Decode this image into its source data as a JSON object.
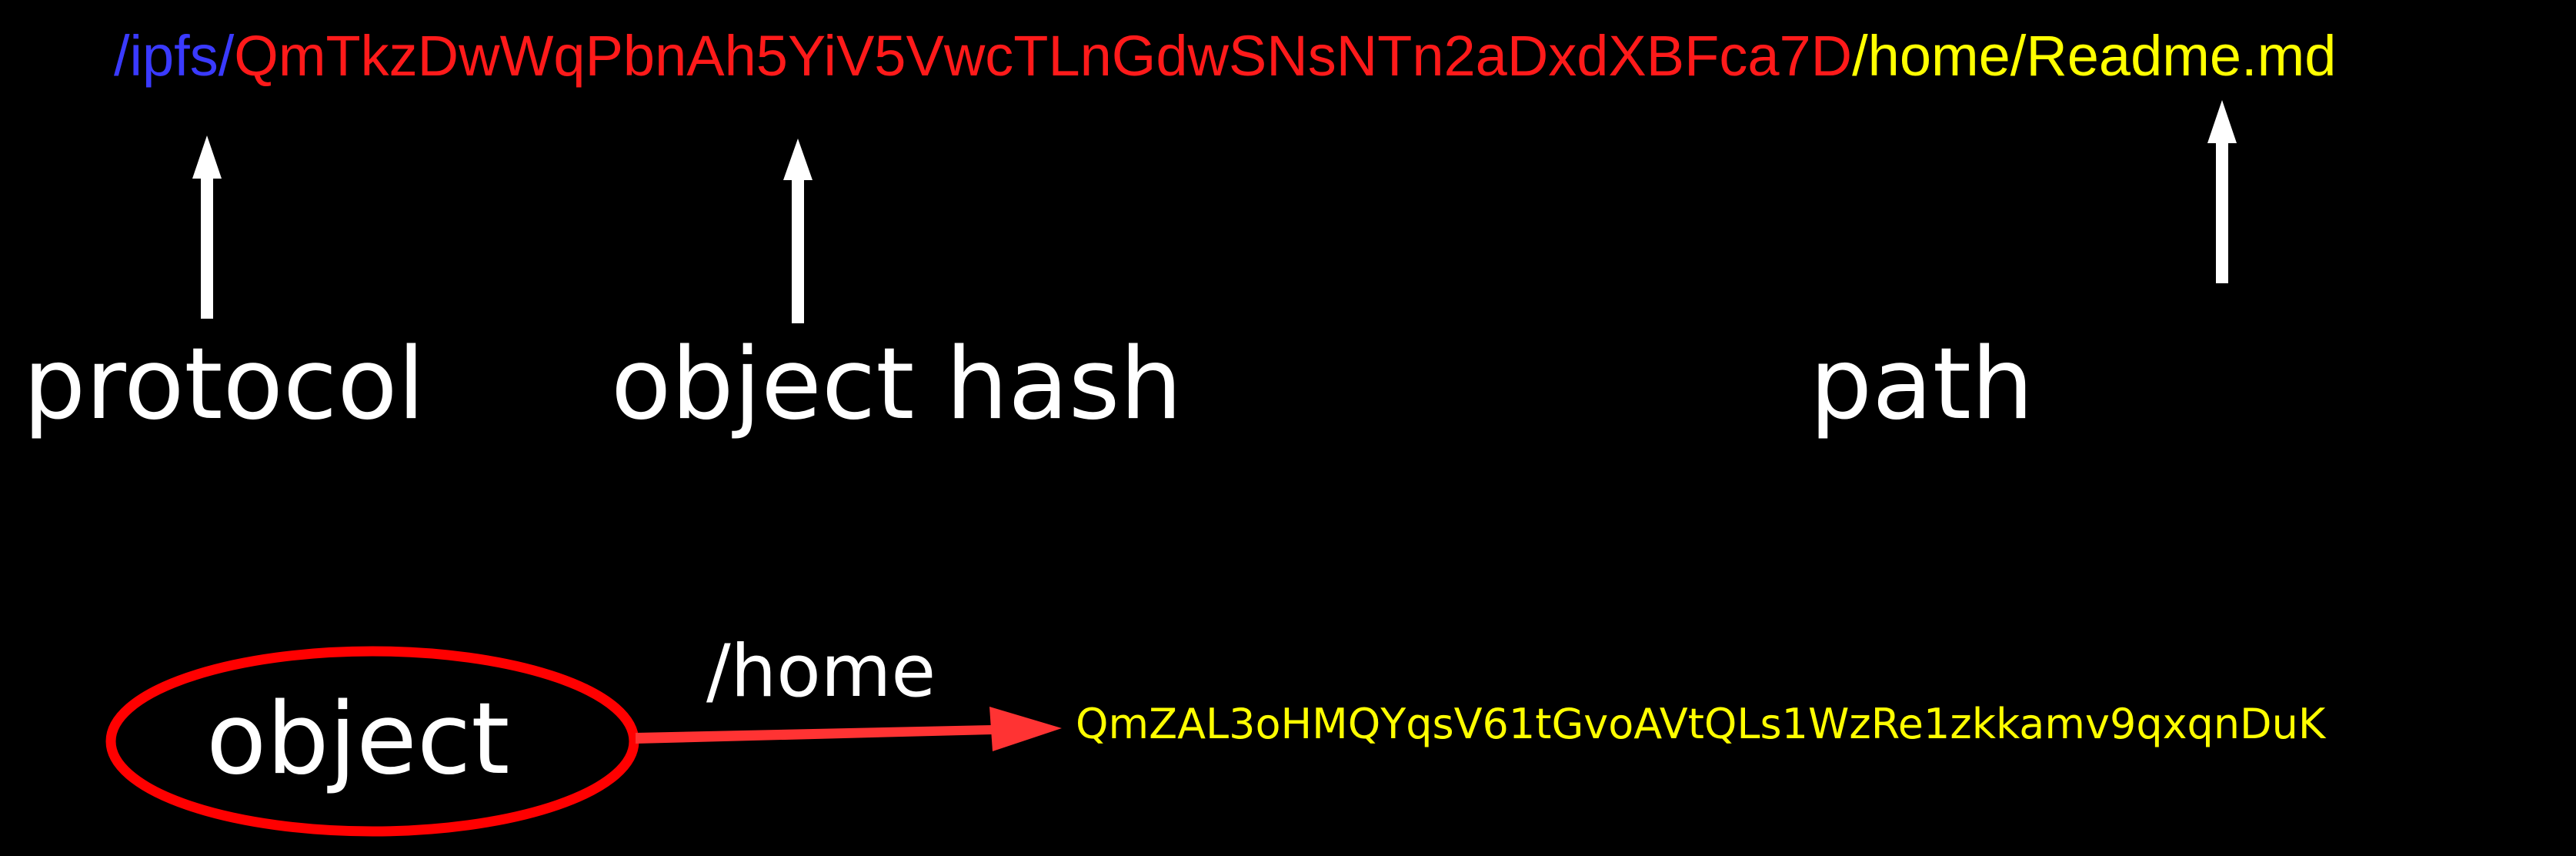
{
  "url": {
    "protocol": "/ipfs/",
    "hash": "QmTkzDwWqPbnAh5YiV5VwcTLnGdwSNsNTn2aDxdXBFca7D",
    "path": "/home/Readme.md"
  },
  "labels": {
    "protocol": "protocol",
    "object_hash": "object hash",
    "path": "path"
  },
  "link": {
    "node": "object",
    "edge_label": "/home",
    "target_hash": "QmZAL3oHMQYqsV61tGvoAVtQLs1WzRe1zkkamv9qxqnDuK"
  },
  "colors": {
    "background": "#000000",
    "protocol": "#3a3aff",
    "hash": "#ff1a1a",
    "path": "#ffff00",
    "label": "#ffffff",
    "node_outline": "#ff0000",
    "edge": "#ff3333"
  },
  "icons": {
    "arrow_up": "white-up-arrow",
    "arrow_right": "red-right-arrow"
  }
}
